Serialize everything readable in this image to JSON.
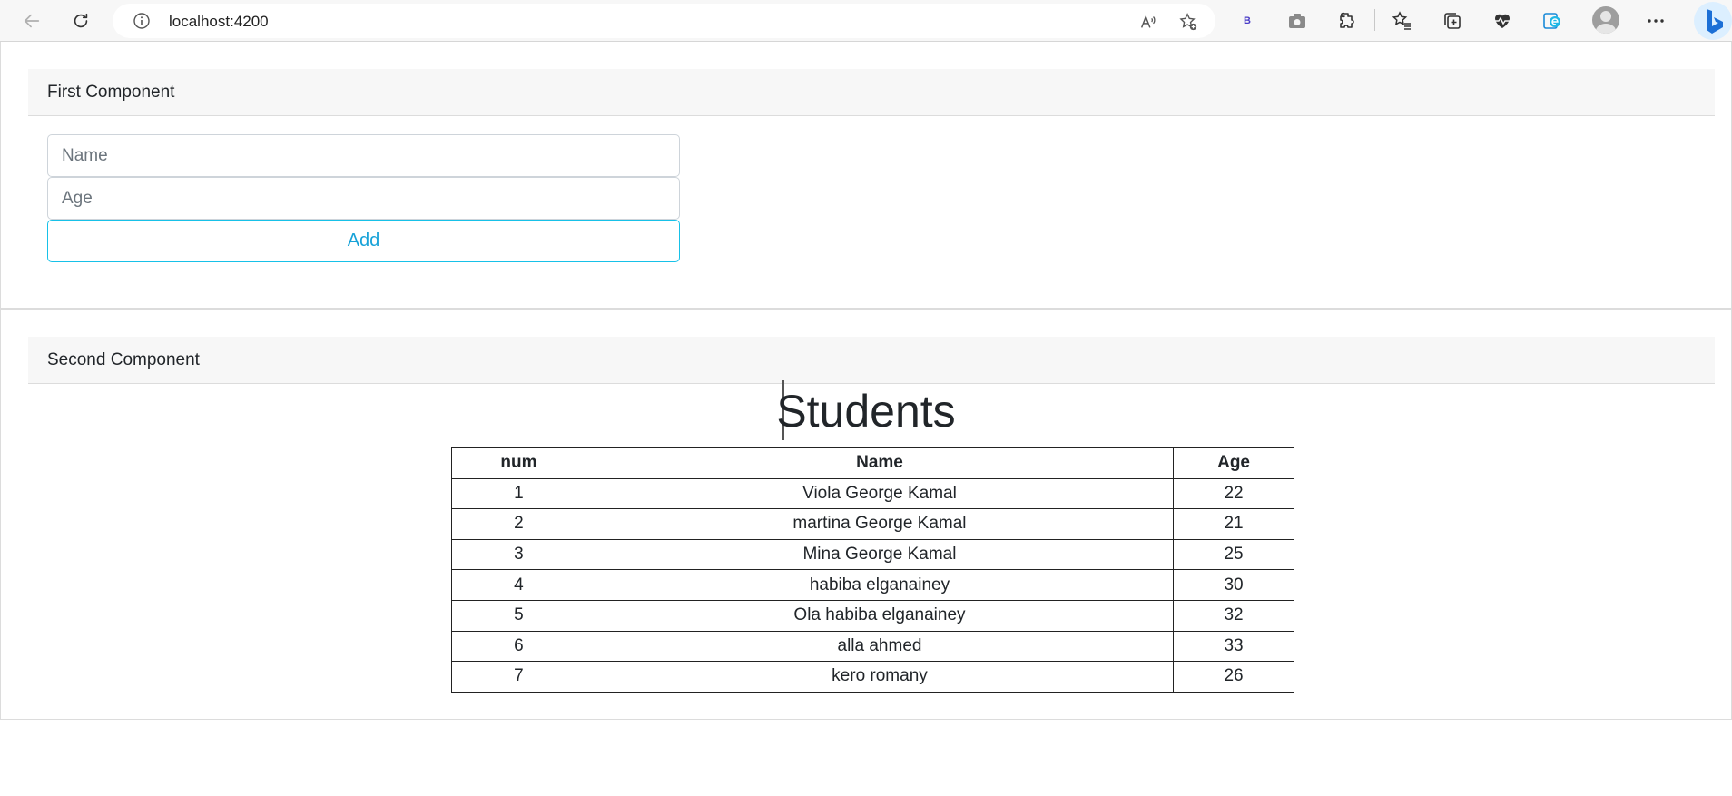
{
  "browser": {
    "url": "localhost:4200",
    "extension_badge": "B",
    "icons": [
      "back-icon",
      "refresh-icon",
      "info-icon",
      "read-aloud-icon",
      "add-favorite-icon",
      "screenshot-icon",
      "extensions-icon",
      "favorites-icon",
      "collections-icon",
      "browser-essentials-icon",
      "edge-icon",
      "profile-icon",
      "more-icon",
      "bing-icon"
    ]
  },
  "first_component": {
    "title": "First Component",
    "name_placeholder": "Name",
    "age_placeholder": "Age",
    "add_label": "Add"
  },
  "second_component": {
    "title": "Second Component",
    "heading": "Students",
    "table": {
      "headers": [
        "num",
        "Name",
        "Age"
      ],
      "rows": [
        [
          "1",
          "Viola George Kamal",
          "22"
        ],
        [
          "2",
          "martina George Kamal",
          "21"
        ],
        [
          "3",
          "Mina George Kamal",
          "25"
        ],
        [
          "4",
          "habiba elganainey",
          "30"
        ],
        [
          "5",
          "Ola habiba elganainey",
          "32"
        ],
        [
          "6",
          "alla ahmed",
          "33"
        ],
        [
          "7",
          "kero romany",
          "26"
        ]
      ]
    }
  },
  "colors": {
    "accent": "#17c1e8",
    "header_bg": "#f7f7f7",
    "border": "#dcdcdc"
  }
}
